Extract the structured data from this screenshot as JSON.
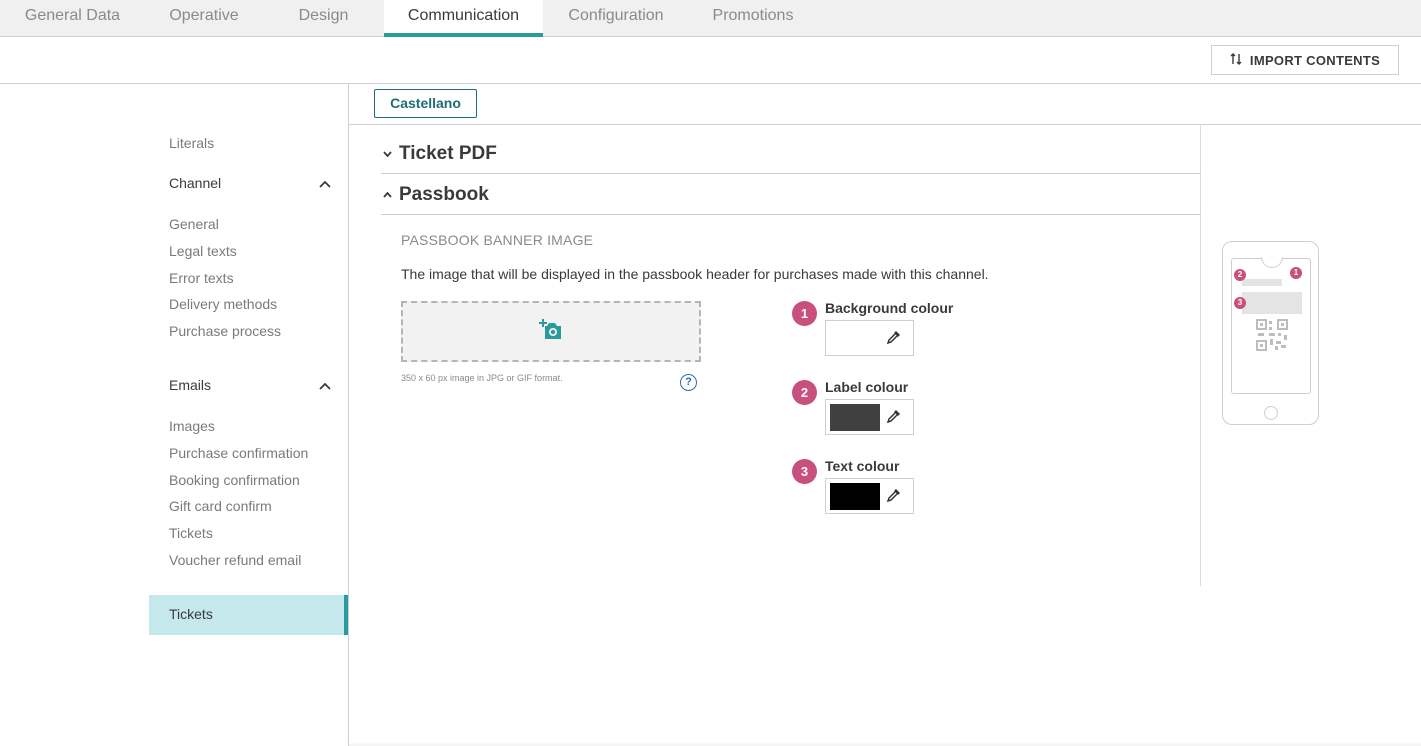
{
  "tabs": [
    {
      "label": "General Data"
    },
    {
      "label": "Operative"
    },
    {
      "label": "Design"
    },
    {
      "label": "Communication"
    },
    {
      "label": "Configuration"
    },
    {
      "label": "Promotions"
    }
  ],
  "active_tab": "Communication",
  "toolbar": {
    "import_label": "IMPORT CONTENTS"
  },
  "sidebar": {
    "literals": "Literals",
    "channel": {
      "label": "Channel",
      "items": [
        "General",
        "Legal texts",
        "Error texts",
        "Delivery methods",
        "Purchase process"
      ]
    },
    "emails": {
      "label": "Emails",
      "items": [
        "Images",
        "Purchase confirmation",
        "Booking confirmation",
        "Gift card confirm",
        "Tickets",
        "Voucher refund email"
      ]
    },
    "active_item": "Tickets"
  },
  "language": {
    "selected": "Castellano"
  },
  "sections": {
    "ticket_pdf": "Ticket PDF",
    "passbook": "Passbook"
  },
  "passbook": {
    "banner_title": "PASSBOOK BANNER IMAGE",
    "banner_desc": "The image that will be displayed in the passbook header for purchases made with this channel.",
    "upload_hint": "350 x 60 px image in JPG or GIF format.",
    "help_symbol": "?",
    "colours": [
      {
        "number": "1",
        "label": "Background colour",
        "value": "#ffffff"
      },
      {
        "number": "2",
        "label": "Label colour",
        "value": "#404040"
      },
      {
        "number": "3",
        "label": "Text colour",
        "value": "#000000"
      }
    ]
  },
  "preview": {
    "badges": [
      "1",
      "2",
      "3"
    ]
  },
  "colors": {
    "accent": "#2b9a9c",
    "badge": "#c94f7c",
    "sidebar_active_bg": "#c4e8ec"
  }
}
